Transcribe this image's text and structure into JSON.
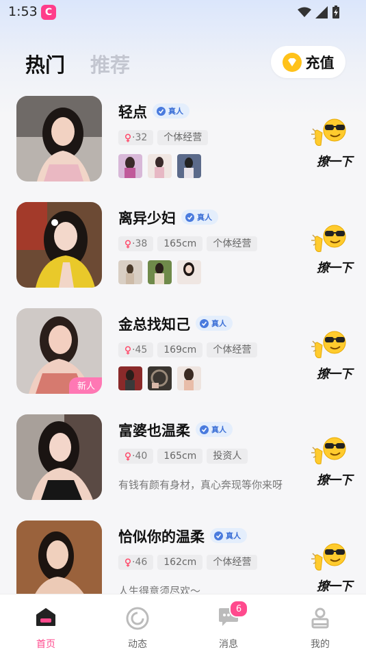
{
  "status_bar": {
    "time": "1:53"
  },
  "header": {
    "tabs": [
      "热门",
      "推荐"
    ],
    "recharge_label": "充值"
  },
  "profiles": [
    {
      "name": "轻点",
      "verified": "真人",
      "age": "·32",
      "tags": [
        "个体经营"
      ],
      "greet": "撩一下",
      "has_photos": true
    },
    {
      "name": "离异少妇",
      "verified": "真人",
      "age": "·38",
      "tags": [
        "165cm",
        "个体经营"
      ],
      "greet": "撩一下",
      "has_photos": true
    },
    {
      "name": "金总找知己",
      "verified": "真人",
      "age": "·45",
      "tags": [
        "169cm",
        "个体经营"
      ],
      "greet": "撩一下",
      "has_photos": true,
      "new_tag": "新人"
    },
    {
      "name": "富婆也温柔",
      "verified": "真人",
      "age": "·40",
      "tags": [
        "165cm",
        "投资人"
      ],
      "greet": "撩一下",
      "signature": "有钱有颜有身材，真心奔现等你来呀"
    },
    {
      "name": "恰似你的温柔",
      "verified": "真人",
      "age": "·46",
      "tags": [
        "162cm",
        "个体经营"
      ],
      "greet": "撩一下",
      "signature": "人生得意须尽欢～"
    }
  ],
  "tabbar": {
    "items": [
      {
        "label": "首页",
        "icon": "home-icon",
        "active": true
      },
      {
        "label": "动态",
        "icon": "moments-icon"
      },
      {
        "label": "消息",
        "icon": "message-icon",
        "badge": "6"
      },
      {
        "label": "我的",
        "icon": "profile-icon"
      }
    ]
  },
  "colors": {
    "accent": "#ff4a8d",
    "verified": "#4a7bde",
    "coin": "#ffc21a"
  }
}
